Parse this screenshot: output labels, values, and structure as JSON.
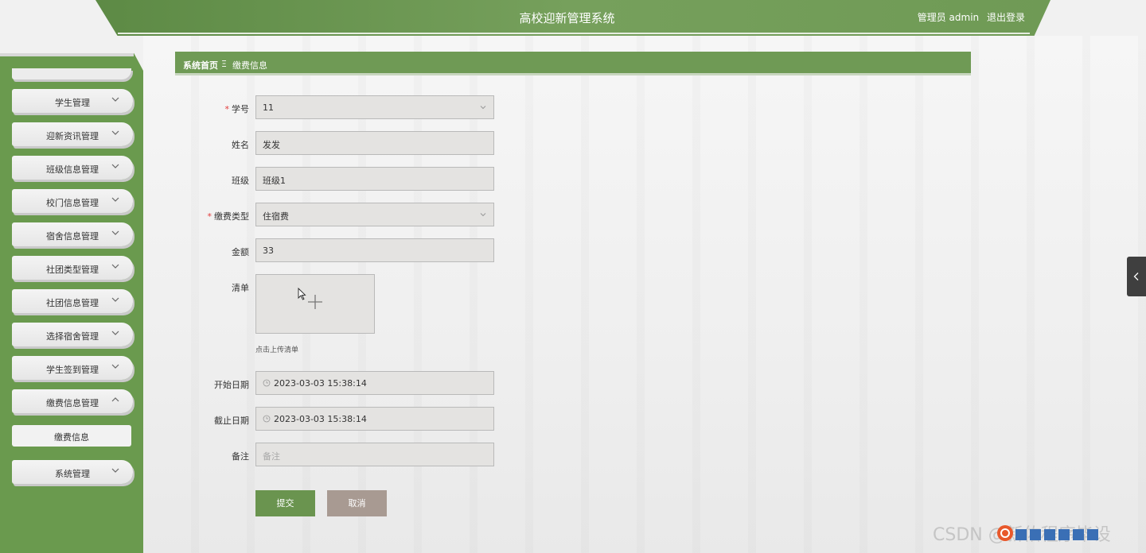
{
  "header": {
    "title": "高校迎新管理系统",
    "user_role": "管理员 admin",
    "logout": "退出登录"
  },
  "sidebar": {
    "items": [
      {
        "label": "学生管理"
      },
      {
        "label": "迎新资讯管理"
      },
      {
        "label": "班级信息管理"
      },
      {
        "label": "校门信息管理"
      },
      {
        "label": "宿舍信息管理"
      },
      {
        "label": "社团类型管理"
      },
      {
        "label": "社团信息管理"
      },
      {
        "label": "选择宿舍管理"
      },
      {
        "label": "学生签到管理"
      },
      {
        "label": "缴费信息管理"
      },
      {
        "label": "系统管理"
      }
    ],
    "active_sub": "缴费信息"
  },
  "breadcrumb": {
    "home": "系统首页",
    "separator": "Ξ",
    "current": "缴费信息"
  },
  "form": {
    "student_no": {
      "label": "学号",
      "value": "11",
      "required": true
    },
    "name": {
      "label": "姓名",
      "value": "发发"
    },
    "class": {
      "label": "班级",
      "value": "班级1"
    },
    "fee_type": {
      "label": "缴费类型",
      "value": "住宿费",
      "required": true
    },
    "amount": {
      "label": "金额",
      "value": "33"
    },
    "list": {
      "label": "清单",
      "hint": "点击上传清单"
    },
    "start_date": {
      "label": "开始日期",
      "value": "2023-03-03 15:38:14"
    },
    "end_date": {
      "label": "截止日期",
      "value": "2023-03-03 15:38:14"
    },
    "remark": {
      "label": "备注",
      "placeholder": "备注"
    },
    "submit": "提交",
    "cancel": "取消",
    "required_mark": "*"
  },
  "watermark": "CSDN @新佑程序毕设",
  "colors": {
    "primary_green": "#6a944f",
    "header_green": "#6f9a55",
    "cancel_brown": "#a89a92",
    "required_red": "#e23a3a"
  }
}
